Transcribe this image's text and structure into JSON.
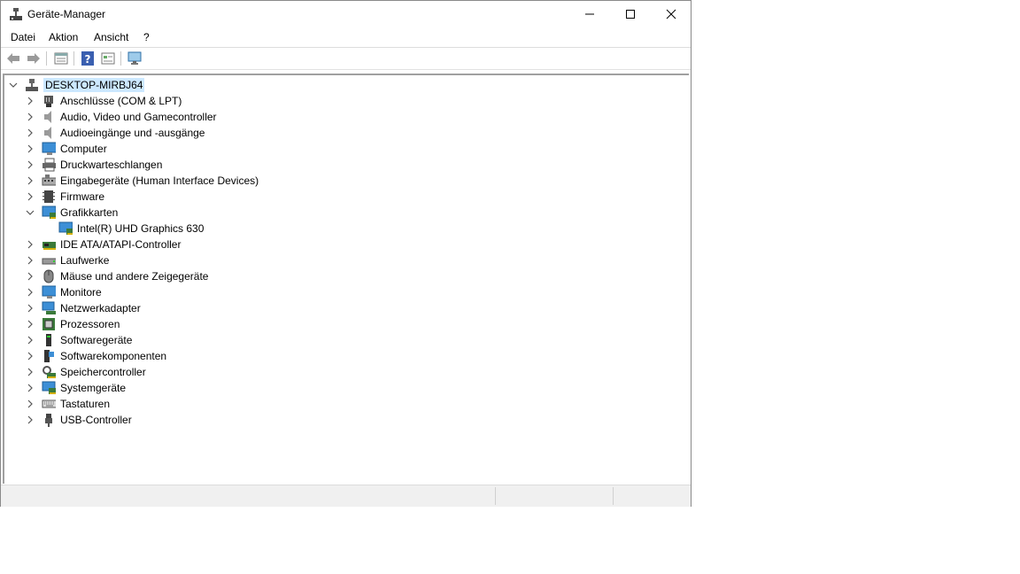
{
  "window": {
    "title": "Geräte-Manager"
  },
  "menu": [
    {
      "label": "Datei"
    },
    {
      "label": "Aktion"
    },
    {
      "label": "Ansicht"
    },
    {
      "label": "?"
    }
  ],
  "toolbar": [
    "back-icon",
    "forward-icon",
    "properties-view-icon",
    "help-icon",
    "view-icon",
    "monitor-scan-icon"
  ],
  "tree": {
    "root": {
      "label": "DESKTOP-MIRBJ64",
      "expanded": true
    },
    "categories": [
      {
        "label": "Anschlüsse (COM & LPT)",
        "icon": "port-icon",
        "expanded": false
      },
      {
        "label": "Audio, Video und Gamecontroller",
        "icon": "speaker-icon",
        "expanded": false
      },
      {
        "label": "Audioeingänge und -ausgänge",
        "icon": "speaker-icon",
        "expanded": false
      },
      {
        "label": "Computer",
        "icon": "computer-icon",
        "expanded": false
      },
      {
        "label": "Druckwarteschlangen",
        "icon": "printer-icon",
        "expanded": false
      },
      {
        "label": "Eingabegeräte (Human Interface Devices)",
        "icon": "hid-icon",
        "expanded": false
      },
      {
        "label": "Firmware",
        "icon": "chip-icon",
        "expanded": false
      },
      {
        "label": "Grafikkarten",
        "icon": "display-adapter-icon",
        "expanded": true,
        "children": [
          {
            "label": "Intel(R) UHD Graphics 630",
            "icon": "display-adapter-icon"
          }
        ]
      },
      {
        "label": "IDE ATA/ATAPI-Controller",
        "icon": "ide-controller-icon",
        "expanded": false
      },
      {
        "label": "Laufwerke",
        "icon": "drive-icon",
        "expanded": false
      },
      {
        "label": "Mäuse und andere Zeigegeräte",
        "icon": "mouse-icon",
        "expanded": false
      },
      {
        "label": "Monitore",
        "icon": "monitor-icon",
        "expanded": false
      },
      {
        "label": "Netzwerkadapter",
        "icon": "network-icon",
        "expanded": false
      },
      {
        "label": "Prozessoren",
        "icon": "processor-icon",
        "expanded": false
      },
      {
        "label": "Softwaregeräte",
        "icon": "software-device-icon",
        "expanded": false
      },
      {
        "label": "Softwarekomponenten",
        "icon": "software-component-icon",
        "expanded": false
      },
      {
        "label": "Speichercontroller",
        "icon": "storage-controller-icon",
        "expanded": false
      },
      {
        "label": "Systemgeräte",
        "icon": "system-device-icon",
        "expanded": false
      },
      {
        "label": "Tastaturen",
        "icon": "keyboard-icon",
        "expanded": false
      },
      {
        "label": "USB-Controller",
        "icon": "usb-icon",
        "expanded": false
      }
    ]
  },
  "colors": {
    "selection": "#cce8ff",
    "accent": "#0a64c8"
  }
}
